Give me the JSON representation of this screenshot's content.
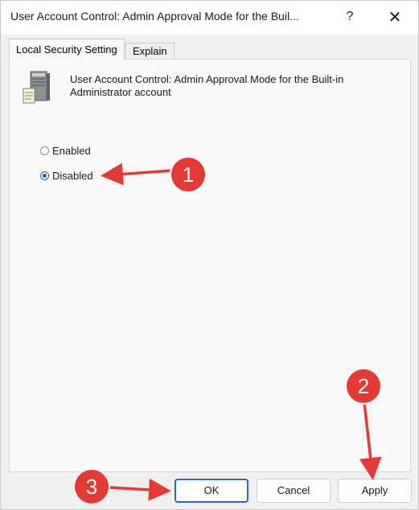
{
  "window": {
    "title": "User Account Control: Admin Approval Mode for the Buil...",
    "help_glyph": "?",
    "close_glyph": "✕"
  },
  "tabs": [
    {
      "label": "Local Security Setting",
      "active": true
    },
    {
      "label": "Explain",
      "active": false
    }
  ],
  "policy": {
    "icon": "server-policy-icon",
    "description": "User Account Control: Admin Approval Mode for the Built-in Administrator account"
  },
  "options": [
    {
      "label": "Enabled",
      "selected": false
    },
    {
      "label": "Disabled",
      "selected": true
    }
  ],
  "buttons": {
    "ok": "OK",
    "cancel": "Cancel",
    "apply": "Apply"
  },
  "annotations": {
    "color": "#e53935",
    "steps": [
      "1",
      "2",
      "3"
    ]
  },
  "colors": {
    "accent": "#2a65c7",
    "annotation": "#e53935"
  }
}
